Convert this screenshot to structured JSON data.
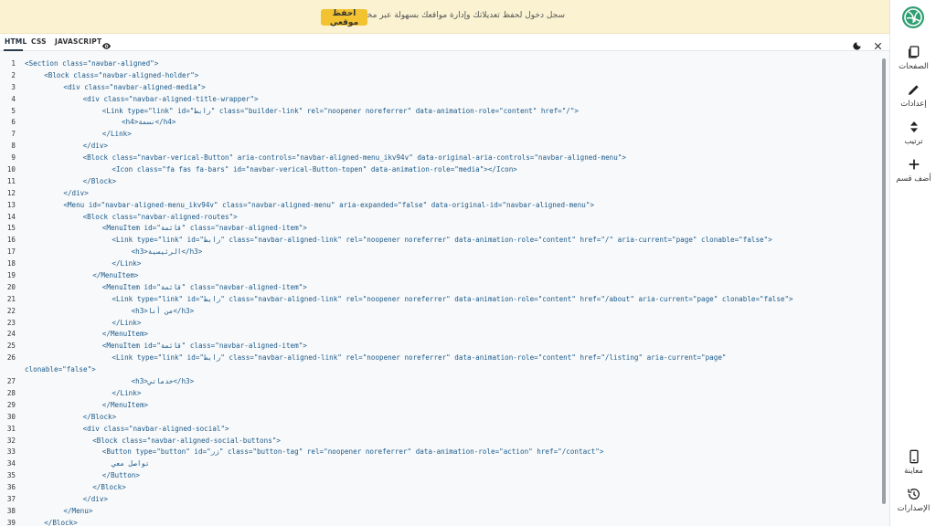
{
  "banner": {
    "text": "سجل دخول لحفظ تعديلاتك وإدارة مواقعك بسهولة عبر مختلف الأجهزة",
    "button_label": "احفظ موقعي"
  },
  "tabs": [
    {
      "label": "HTML",
      "active": true
    },
    {
      "label": "CSS",
      "active": false
    },
    {
      "label": "JAVASCRIPT",
      "active": false
    }
  ],
  "sidebar": {
    "items": [
      {
        "label": "الصفحات",
        "icon": "pages-icon"
      },
      {
        "label": "إعدادات",
        "icon": "pencil-icon"
      },
      {
        "label": "ترتيب",
        "icon": "sort-icon"
      },
      {
        "label": "أضف قسم",
        "icon": "plus-icon"
      }
    ],
    "bottom_items": [
      {
        "label": "معاينة",
        "icon": "mobile-icon"
      },
      {
        "label": "الإصدارات",
        "icon": "history-icon"
      }
    ]
  },
  "colors": {
    "banner_bg": "#fbf2d2",
    "banner_button": "#f2c230",
    "code_text": "#1d5a8a",
    "editor_bg": "#f7f9fa"
  },
  "code_lines": [
    {
      "n": "1",
      "indent": 0,
      "text": "<Section class=\"navbar-aligned\">"
    },
    {
      "n": "2",
      "indent": 2,
      "text": "<Block class=\"navbar-aligned-holder\">"
    },
    {
      "n": "3",
      "indent": 4,
      "text": "<div class=\"navbar-aligned-media\">"
    },
    {
      "n": "4",
      "indent": 6,
      "text": "<div class=\"navbar-aligned-title-wrapper\">"
    },
    {
      "n": "5",
      "indent": 8,
      "text": "<Link type=\"link\" id=\"رابط\" class=\"builder-link\" rel=\"noopener noreferrer\" data-animation-role=\"content\" href=\"/\">"
    },
    {
      "n": "6",
      "indent": 10,
      "text": "<h4>نسمة</h4>"
    },
    {
      "n": "7",
      "indent": 8,
      "text": "</Link>"
    },
    {
      "n": "8",
      "indent": 6,
      "text": "</div>"
    },
    {
      "n": "9",
      "indent": 6,
      "text": "<Block class=\"navbar-verical-Button\" aria-controls=\"navbar-aligned-menu_ikv94v\" data-original-aria-controls=\"navbar-aligned-menu\">"
    },
    {
      "n": "10",
      "indent": 9,
      "text": "<Icon class=\"fa fas fa-bars\" id=\"navbar-verical-Button-topen\" data-animation-role=\"media\"></Icon>"
    },
    {
      "n": "11",
      "indent": 6,
      "text": "</Block>"
    },
    {
      "n": "12",
      "indent": 4,
      "text": "</div>"
    },
    {
      "n": "13",
      "indent": 4,
      "text": "<Menu id=\"navbar-aligned-menu_ikv94v\" class=\"navbar-aligned-menu\" aria-expanded=\"false\" data-original-id=\"navbar-aligned-menu\">"
    },
    {
      "n": "14",
      "indent": 6,
      "text": "<Block class=\"navbar-aligned-routes\">"
    },
    {
      "n": "15",
      "indent": 8,
      "text": "<MenuItem id=\"قائمة\" class=\"navbar-aligned-item\">"
    },
    {
      "n": "16",
      "indent": 9,
      "text": "<Link type=\"link\" id=\"رابط\" class=\"navbar-aligned-link\" rel=\"noopener noreferrer\" data-animation-role=\"content\" href=\"/\" aria-current=\"page\" clonable=\"false\">"
    },
    {
      "n": "17",
      "indent": 11,
      "text": "<h3>الرئيسية</h3>"
    },
    {
      "n": "18",
      "indent": 9,
      "text": "</Link>"
    },
    {
      "n": "19",
      "indent": 7,
      "text": "</MenuItem>"
    },
    {
      "n": "20",
      "indent": 8,
      "text": "<MenuItem id=\"قائمة\" class=\"navbar-aligned-item\">"
    },
    {
      "n": "21",
      "indent": 9,
      "text": "<Link type=\"link\" id=\"رابط\" class=\"navbar-aligned-link\" rel=\"noopener noreferrer\" data-animation-role=\"content\" href=\"/about\" aria-current=\"page\" clonable=\"false\">"
    },
    {
      "n": "22",
      "indent": 11,
      "text": "<h3>من أنا</h3>"
    },
    {
      "n": "23",
      "indent": 9,
      "text": "</Link>"
    },
    {
      "n": "24",
      "indent": 8,
      "text": "</MenuItem>"
    },
    {
      "n": "25",
      "indent": 8,
      "text": "<MenuItem id=\"قائمة\" class=\"navbar-aligned-item\">"
    },
    {
      "n": "26",
      "indent": 9,
      "text": "<Link type=\"link\" id=\"رابط\" class=\"navbar-aligned-link\" rel=\"noopener noreferrer\" data-animation-role=\"content\" href=\"/listing\" aria-current=\"page\""
    },
    {
      "n": "",
      "indent": 0,
      "text": "clonable=\"false\">"
    },
    {
      "n": "27",
      "indent": 11,
      "text": "<h3>خدماتي</h3>"
    },
    {
      "n": "28",
      "indent": 9,
      "text": "</Link>"
    },
    {
      "n": "29",
      "indent": 8,
      "text": "</MenuItem>"
    },
    {
      "n": "30",
      "indent": 6,
      "text": "</Block>"
    },
    {
      "n": "31",
      "indent": 6,
      "text": "<div class=\"navbar-aligned-social\">"
    },
    {
      "n": "32",
      "indent": 7,
      "text": "<Block class=\"navbar-aligned-social-buttons\">"
    },
    {
      "n": "33",
      "indent": 8,
      "text": "<Button type=\"button\" id=\"زر\" class=\"button-tag\" rel=\"noopener noreferrer\" data-animation-role=\"action\" href=\"/contact\">"
    },
    {
      "n": "34",
      "indent": 9,
      "text": "تواصل معي"
    },
    {
      "n": "35",
      "indent": 8,
      "text": "</Button>"
    },
    {
      "n": "36",
      "indent": 7,
      "text": "</Block>"
    },
    {
      "n": "37",
      "indent": 6,
      "text": "</div>"
    },
    {
      "n": "38",
      "indent": 4,
      "text": "</Menu>"
    },
    {
      "n": "39",
      "indent": 2,
      "text": "</Block>"
    }
  ]
}
